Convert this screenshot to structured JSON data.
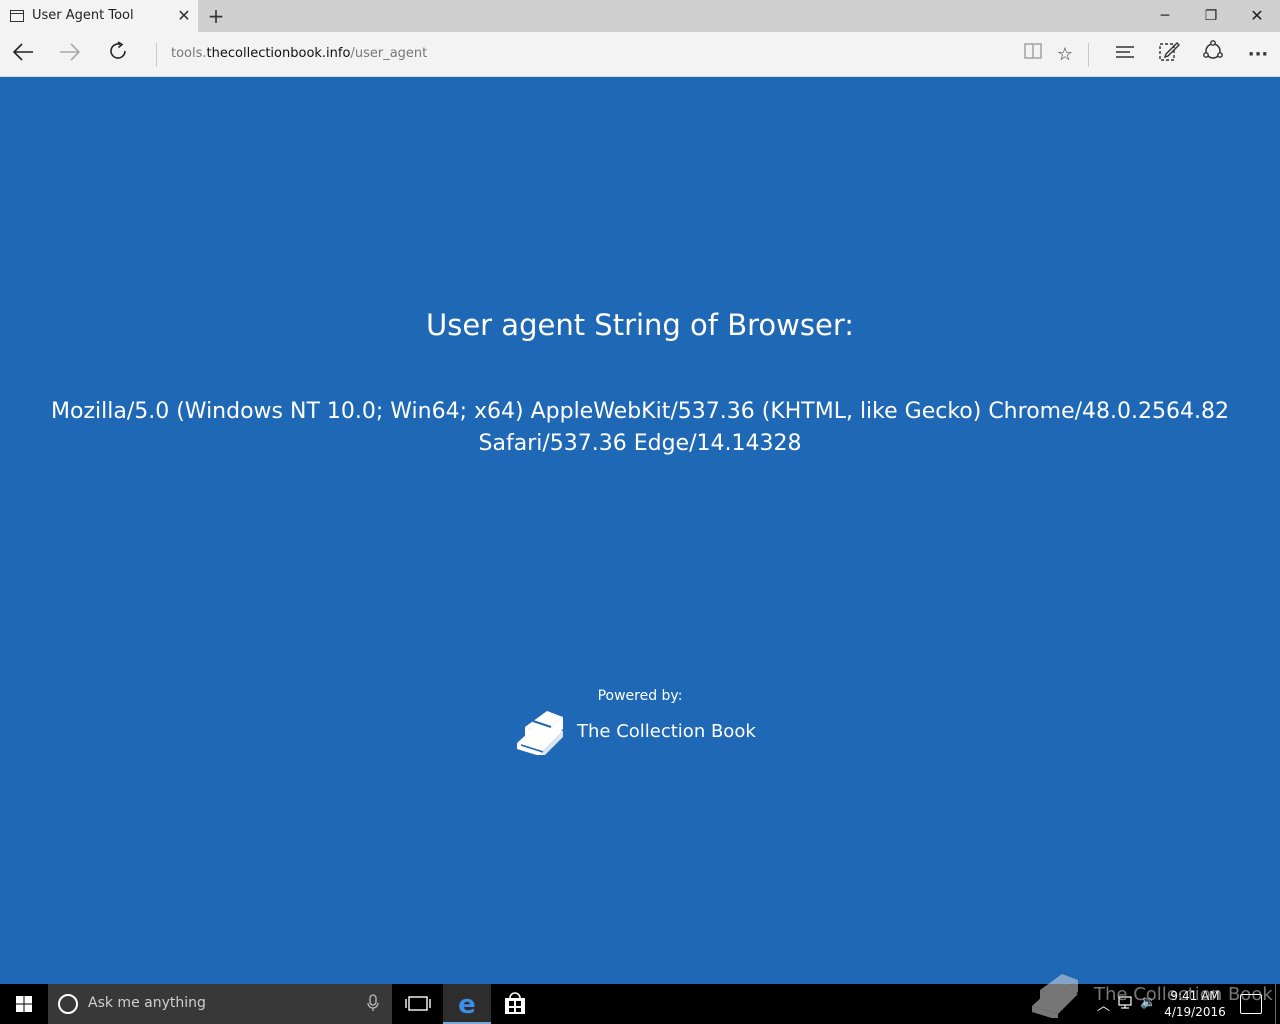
{
  "browser": {
    "tab_title": "User Agent Tool",
    "new_tab_symbol": "+",
    "address": {
      "prefix": "tools.",
      "domain": "thecollectionbook.info",
      "path": "/user_agent"
    }
  },
  "page": {
    "heading": "User agent String of Browser:",
    "ua_string": "Mozilla/5.0 (Windows NT 10.0; Win64; x64) AppleWebKit/537.36 (KHTML, like Gecko) Chrome/48.0.2564.82 Safari/537.36 Edge/14.14328",
    "powered_by": "Powered by:",
    "brand_name": "The Collection Book"
  },
  "taskbar": {
    "search_placeholder": "Ask me anything",
    "time": "9:41 AM",
    "date": "4/19/2016"
  },
  "watermark": {
    "text": "The Collection Book"
  },
  "colors": {
    "page_background": "#1f68b5",
    "taskbar": "#000000",
    "chrome": "#f3f3f3"
  },
  "icons": [
    "tab-page-icon",
    "close-icon",
    "plus-icon",
    "minimize-icon",
    "restore-icon",
    "back-arrow-icon",
    "forward-arrow-icon",
    "refresh-icon",
    "reading-view-icon",
    "star-icon",
    "hub-icon",
    "web-note-icon",
    "share-icon",
    "more-icon",
    "book-icon",
    "windows-logo-icon",
    "cortana-icon",
    "microphone-icon",
    "task-view-icon",
    "edge-icon",
    "store-icon",
    "speaker-icon",
    "notification-icon"
  ]
}
